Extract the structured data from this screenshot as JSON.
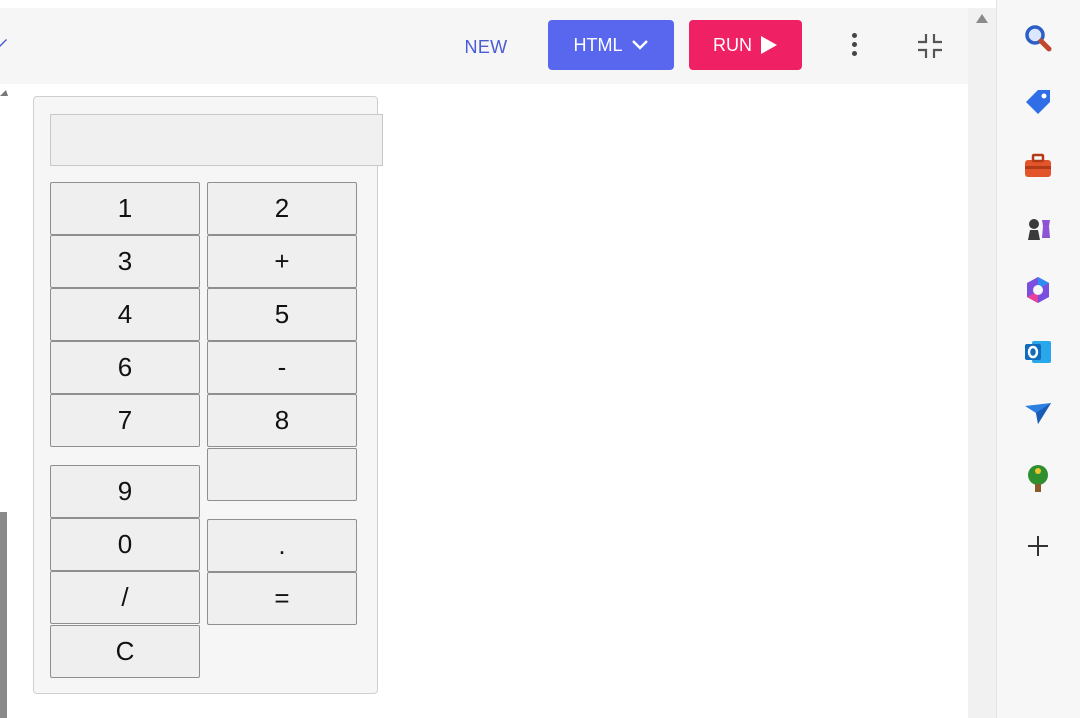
{
  "toolbar": {
    "new_label": "NEW",
    "language_label": "HTML",
    "run_label": "RUN"
  },
  "calculator": {
    "display_value": "",
    "keys": {
      "k1": "1",
      "k2": "2",
      "k3": "3",
      "kplus": "+",
      "k4": "4",
      "k5": "5",
      "k6": "6",
      "kminus": "-",
      "k7": "7",
      "k8": "8",
      "kblank": "",
      "k9": "9",
      "k0": "0",
      "kdot": ".",
      "kdiv": "/",
      "keq": "=",
      "kclear": "C"
    }
  },
  "sidebar": {
    "icons": [
      "search-icon",
      "tag-icon",
      "toolbox-icon",
      "chess-icon",
      "copilot-icon",
      "outlook-icon",
      "send-icon",
      "tree-icon",
      "plus-icon"
    ]
  },
  "colors": {
    "html_button": "#5867ee",
    "run_button": "#ef2063",
    "new_link": "#4a5bd4"
  }
}
